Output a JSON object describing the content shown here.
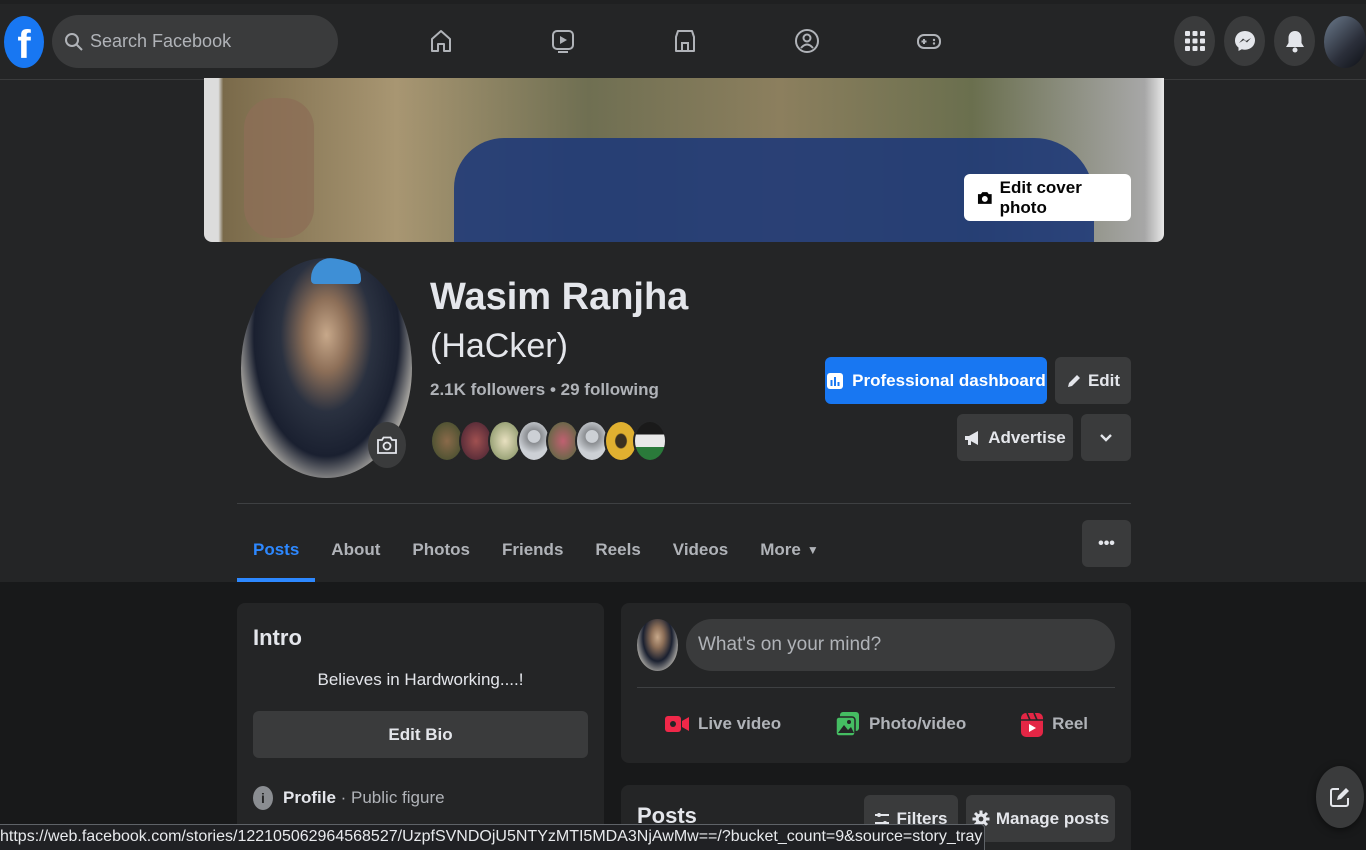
{
  "colors": {
    "accent": "#1877f2",
    "active_tab": "#2d88ff",
    "bg": "#18191a",
    "card": "#242526"
  },
  "topnav": {
    "logo": "f",
    "search_placeholder": "Search Facebook",
    "icons": [
      "home-icon",
      "watch-icon",
      "marketplace-icon",
      "groups-icon",
      "gaming-icon"
    ],
    "right_icons": [
      "menu-grid-icon",
      "messenger-icon",
      "bell-icon",
      "account-avatar"
    ]
  },
  "cover": {
    "edit_label": "Edit cover photo"
  },
  "profile": {
    "name": "Wasim Ranjha",
    "nickname": "(HaCker)",
    "followers_line": "2.1K followers • 29 following"
  },
  "actions": {
    "dashboard": "Professional dashboard",
    "edit": "Edit",
    "advertise": "Advertise"
  },
  "tabs": [
    "Posts",
    "About",
    "Photos",
    "Friends",
    "Reels",
    "Videos",
    "More"
  ],
  "intro": {
    "title": "Intro",
    "bio": "Believes in Hardworking....!",
    "edit_bio": "Edit Bio",
    "profile_label": "Profile",
    "profile_sub": " · Public figure"
  },
  "composer": {
    "placeholder": "What's on your mind?",
    "live": "Live video",
    "photo": "Photo/video",
    "reel": "Reel"
  },
  "posts": {
    "title": "Posts",
    "filters": "Filters",
    "manage": "Manage posts"
  },
  "status_url": "https://web.facebook.com/stories/122105062964568527/UzpfSVNDOjU5NTYzMTI5MDA3NjAwMw==/?bucket_count=9&source=story_tray"
}
